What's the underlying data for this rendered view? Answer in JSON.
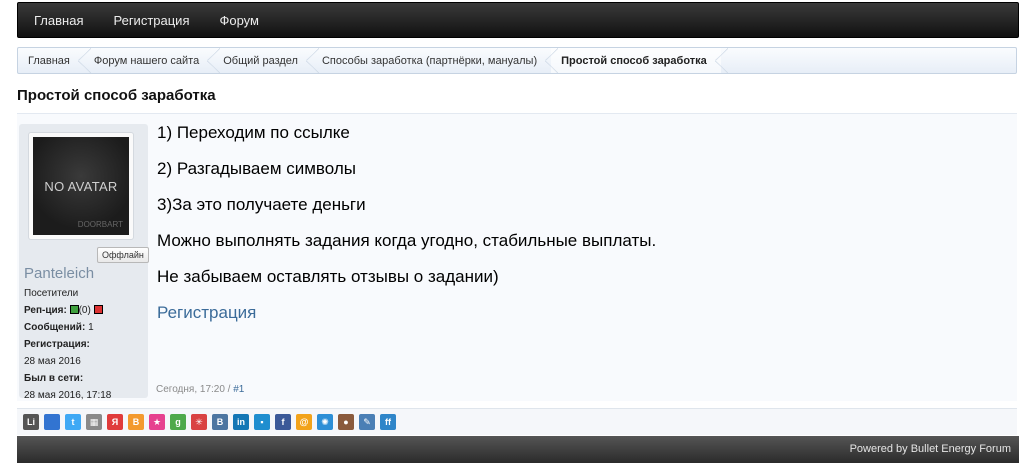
{
  "topnav": {
    "items": [
      "Главная",
      "Регистрация",
      "Форум"
    ]
  },
  "breadcrumb": [
    "Главная",
    "Форум нашего сайта",
    "Общий раздел",
    "Способы заработка (партнёрки, мануалы)",
    "Простой способ заработка"
  ],
  "page_title": "Простой способ заработка",
  "user": {
    "avatar_text": "NO AVATAR",
    "avatar_watermark": "DOORBART",
    "status": "Оффлайн",
    "name": "Panteleich",
    "group": "Посетители",
    "rep_label": "Реп-ция:",
    "rep_value": "(0)",
    "posts_label": "Сообщений:",
    "posts_value": "1",
    "reg_label": "Регистрация:",
    "reg_value": "28 мая 2016",
    "seen_label": "Был в сети:",
    "seen_value": "28 мая 2016, 17:18"
  },
  "message": {
    "lines": [
      "1) Переходим по ссылке",
      "2) Разгадываем символы",
      "3)За это получаете деньги",
      "Можно выполнять задания когда угодно, стабильные выплаты.",
      "Не забываем оставлять отзывы о задании)"
    ],
    "link": "Регистрация"
  },
  "post_meta": {
    "time": "Сегодня, 17:20 / ",
    "number": "#1"
  },
  "share_icons": [
    {
      "name": "linkedin-li-icon",
      "glyph": "Li",
      "color": "#555555"
    },
    {
      "name": "delicious-icon",
      "glyph": "",
      "color": "#3274d1"
    },
    {
      "name": "twitter-icon",
      "glyph": "t",
      "color": "#3fa9f5"
    },
    {
      "name": "myspace-icon",
      "glyph": "▦",
      "color": "#8a8a8a"
    },
    {
      "name": "yandex-icon",
      "glyph": "Я",
      "color": "#e03b3b"
    },
    {
      "name": "blogger-icon",
      "glyph": "B",
      "color": "#f39a2e"
    },
    {
      "name": "favorites-star-icon",
      "glyph": "★",
      "color": "#e6418f"
    },
    {
      "name": "google-plus-icon",
      "glyph": "g",
      "color": "#4ea94b"
    },
    {
      "name": "runner-icon",
      "glyph": "✳",
      "color": "#d94242"
    },
    {
      "name": "vkontakte-icon",
      "glyph": "B",
      "color": "#4d76a1"
    },
    {
      "name": "linkedin-icon",
      "glyph": "in",
      "color": "#1477b5"
    },
    {
      "name": "windows-live-icon",
      "glyph": "▪",
      "color": "#1f8ecf"
    },
    {
      "name": "facebook-icon",
      "glyph": "f",
      "color": "#3b5998"
    },
    {
      "name": "mailru-icon",
      "glyph": "@",
      "color": "#f2a31b"
    },
    {
      "name": "odnoklassniki-icon",
      "glyph": "✺",
      "color": "#2d8fd6"
    },
    {
      "name": "moikrug-icon",
      "glyph": "●",
      "color": "#8a5a3c"
    },
    {
      "name": "livejournal-icon",
      "glyph": "✎",
      "color": "#4a7fb5"
    },
    {
      "name": "friendfeed-icon",
      "glyph": "ff",
      "color": "#2f86c9"
    }
  ],
  "footer": {
    "text": "Powered by Bullet Energy Forum"
  }
}
